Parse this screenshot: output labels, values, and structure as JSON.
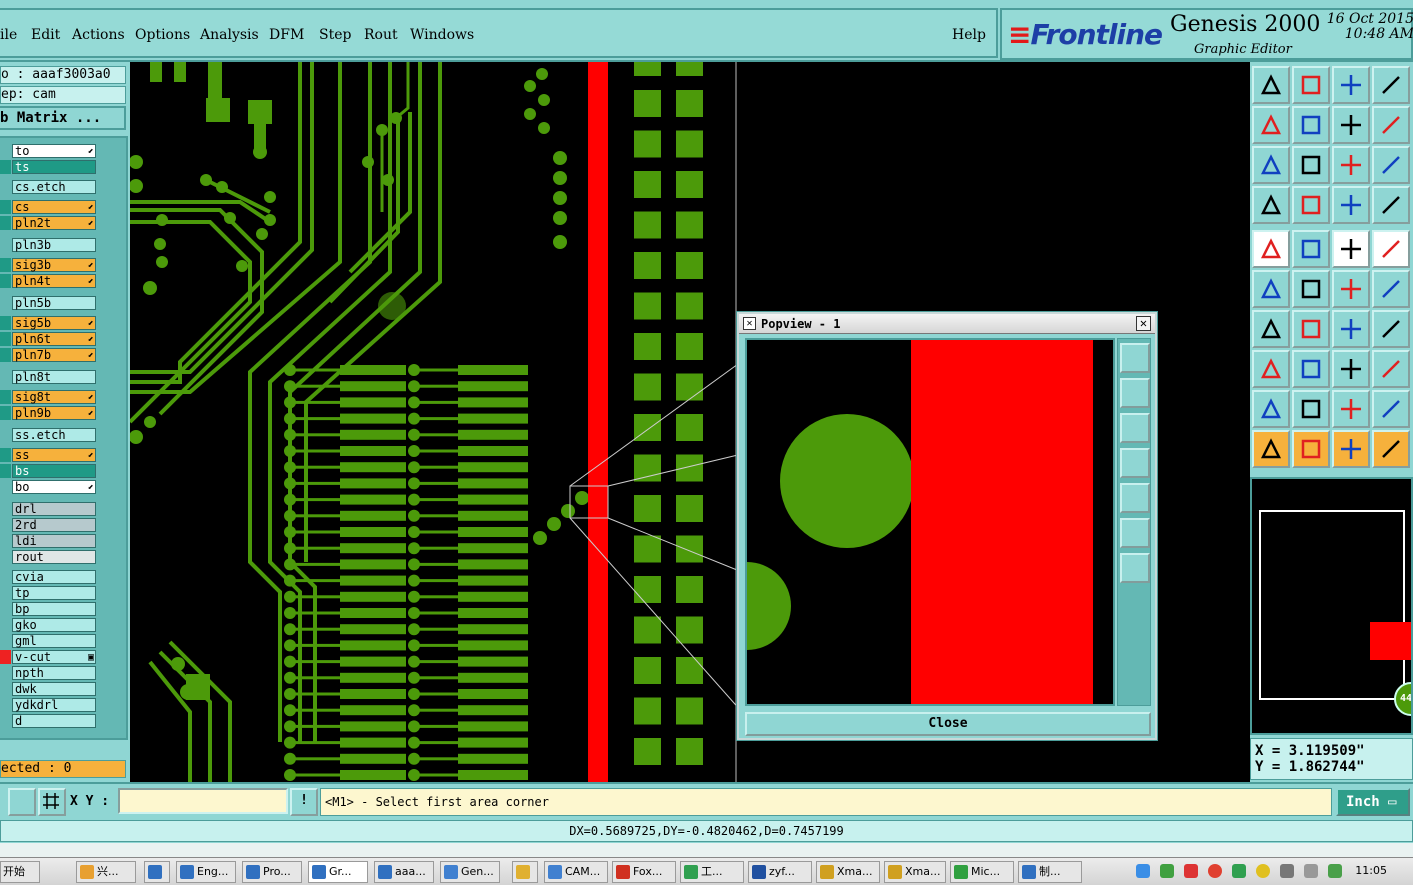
{
  "menu": {
    "items": [
      "ile",
      "Edit",
      "Actions",
      "Options",
      "Analysis",
      "DFM",
      "Step",
      "Rout",
      "Windows"
    ],
    "help": "Help"
  },
  "brand": {
    "logo": "Frontline",
    "product": "Genesis 2000",
    "subtitle": "Graphic Editor",
    "date": "16 Oct 2015",
    "time": "10:48 AM"
  },
  "left": {
    "job": "o : aaaf3003a0",
    "step": "ep: cam",
    "matrix_button": "b Matrix ...",
    "selected": "ected : 0",
    "layers": [
      {
        "name": "to",
        "style": "white",
        "mark": "⬋"
      },
      {
        "name": "ts",
        "style": "active",
        "mark": ""
      },
      {
        "name": "cs.etch",
        "style": "",
        "mark": ""
      },
      {
        "name": "cs",
        "style": "yellow",
        "mark": "⬋"
      },
      {
        "name": "pln2t",
        "style": "yellow",
        "mark": "⬋"
      },
      {
        "name": "pln3b",
        "style": "",
        "mark": ""
      },
      {
        "name": "sig3b",
        "style": "yellow",
        "mark": "⬋"
      },
      {
        "name": "pln4t",
        "style": "yellow",
        "mark": "⬋"
      },
      {
        "name": "pln5b",
        "style": "",
        "mark": ""
      },
      {
        "name": "sig5b",
        "style": "yellow",
        "mark": "⬋"
      },
      {
        "name": "pln6t",
        "style": "yellow",
        "mark": "⬋"
      },
      {
        "name": "pln7b",
        "style": "yellow",
        "mark": "⬋"
      },
      {
        "name": "pln8t",
        "style": "",
        "mark": ""
      },
      {
        "name": "sig8t",
        "style": "yellow",
        "mark": "⬋"
      },
      {
        "name": "pln9b",
        "style": "yellow",
        "mark": "⬋"
      },
      {
        "name": "ss.etch",
        "style": "",
        "mark": ""
      },
      {
        "name": "ss",
        "style": "yellow",
        "mark": "⬋"
      },
      {
        "name": "bs",
        "style": "active",
        "mark": ""
      },
      {
        "name": "bo",
        "style": "white",
        "mark": "⬋"
      },
      {
        "name": "drl",
        "style": "gray",
        "mark": ""
      },
      {
        "name": "2rd",
        "style": "gray",
        "mark": ""
      },
      {
        "name": "ldi",
        "style": "gray",
        "mark": ""
      },
      {
        "name": "rout",
        "style": "lgray",
        "mark": ""
      },
      {
        "name": "cvia",
        "style": "",
        "mark": ""
      },
      {
        "name": "tp",
        "style": "",
        "mark": ""
      },
      {
        "name": "bp",
        "style": "",
        "mark": ""
      },
      {
        "name": "gko",
        "style": "",
        "mark": ""
      },
      {
        "name": "gml",
        "style": "",
        "mark": ""
      },
      {
        "name": "v-cut",
        "style": "",
        "mark": "▣"
      },
      {
        "name": "npth",
        "style": "",
        "mark": ""
      },
      {
        "name": "dwk",
        "style": "",
        "mark": ""
      },
      {
        "name": "ydkdrl",
        "style": "",
        "mark": ""
      },
      {
        "name": "d",
        "style": "",
        "mark": ""
      }
    ]
  },
  "popview": {
    "title": "Popview - 1",
    "close": "Close"
  },
  "coords": {
    "x": "X = 3.119509\"",
    "y": "Y = 1.862744\""
  },
  "overview_badge": "44",
  "command": {
    "xy_label": "X Y :",
    "xy_value": "",
    "prompt": "<M1> - Select first area corner",
    "units": "Inch"
  },
  "measure": "DX=0.5689725,DY=-0.4820462,D=0.7457199",
  "taskbar": {
    "start": "开始",
    "tasks": [
      "兴...",
      "",
      "Eng...",
      "Pro...",
      "Gr...",
      "aaa...",
      "Gen...",
      "",
      "CAM...",
      "Fox...",
      "工...",
      "zyf...",
      "Xma...",
      "Xma...",
      "Mic...",
      "制..."
    ],
    "clock": "11:05"
  },
  "colors": {
    "copper": "#4c9a0a",
    "route": "#ff0000",
    "panel": "#8fd6d3"
  }
}
